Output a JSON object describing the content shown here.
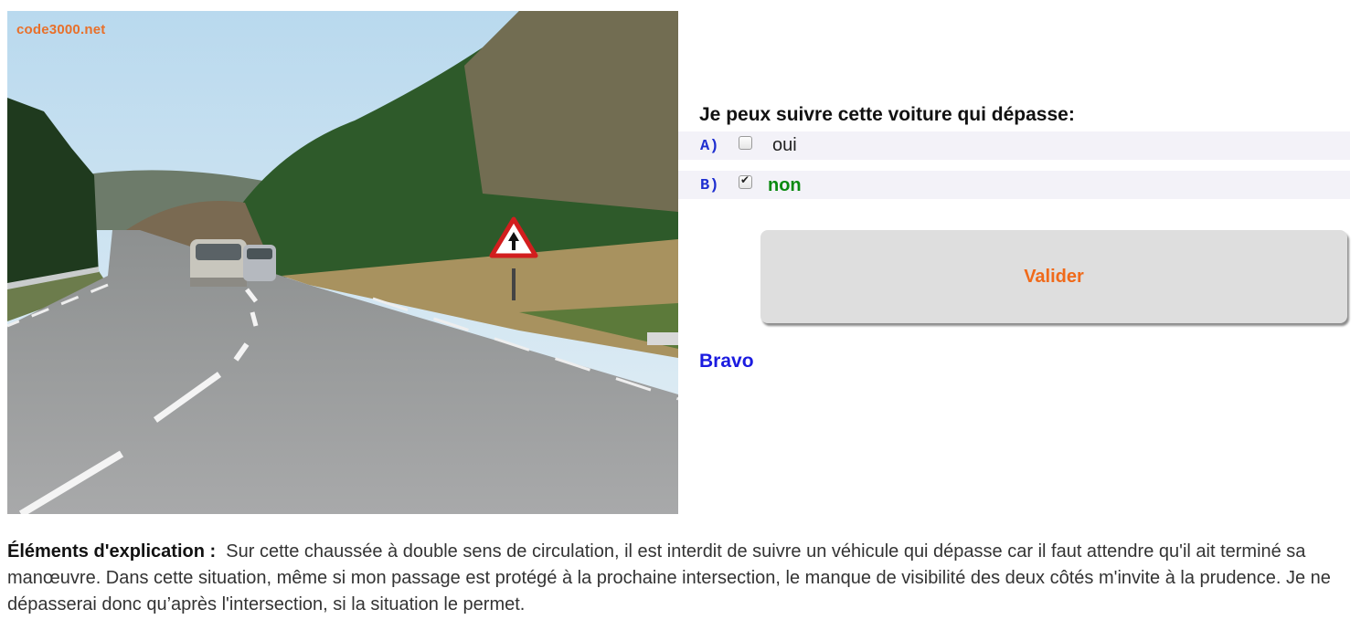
{
  "photo": {
    "watermark": "code3000.net",
    "alt": "road photo"
  },
  "question": {
    "text": "Je peux suivre cette voiture qui dépasse:",
    "answers": [
      {
        "letter": "A)",
        "label": "oui",
        "checked": false
      },
      {
        "letter": "B)",
        "label": "non",
        "checked": true
      }
    ]
  },
  "submit_label": "Valider",
  "feedback": "Bravo",
  "explanation": {
    "heading": "Éléments d'explication :",
    "text": "Sur cette chaussée à double sens de circulation, il est interdit de suivre un véhicule qui dépasse car il faut attendre qu'il ait terminé sa manœuvre. Dans cette situation, même si mon passage est protégé à la prochaine intersection, le manque de visibilité des deux côtés m'invite à la prudence. Je ne dépasserai donc qu’après l'intersection, si la situation le permet."
  },
  "colors": {
    "accent_orange": "#f06a1a",
    "answer_letter_blue": "#1f2fd0",
    "correct_green": "#0a8a10",
    "feedback_blue": "#1b1be0"
  }
}
